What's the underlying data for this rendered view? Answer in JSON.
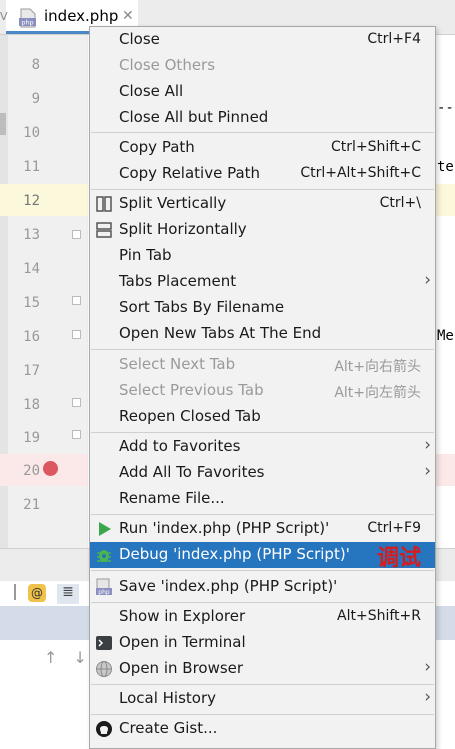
{
  "tab": {
    "title": "index.php",
    "icon": "php-file-icon",
    "file_type_badge": "php"
  },
  "sidebar_letter": "V",
  "line_numbers": [
    "8",
    "9",
    "10",
    "11",
    "12",
    "13",
    "14",
    "15",
    "16",
    "17",
    "18",
    "19",
    "20",
    "21"
  ],
  "editor_fragments": [
    "--",
    "te",
    "Me"
  ],
  "toolbar": {
    "at_icon_label": "@"
  },
  "menu": {
    "close": {
      "label": "Close",
      "shortcut": "Ctrl+F4"
    },
    "close_others": {
      "label": "Close Others"
    },
    "close_all": {
      "label": "Close All"
    },
    "close_all_but_pinned": {
      "label": "Close All but Pinned"
    },
    "copy_path": {
      "label": "Copy Path",
      "shortcut": "Ctrl+Shift+C"
    },
    "copy_relative_path": {
      "label": "Copy Relative Path",
      "shortcut": "Ctrl+Alt+Shift+C"
    },
    "split_vertically": {
      "label": "Split Vertically",
      "shortcut": "Ctrl+\\"
    },
    "split_horizontally": {
      "label": "Split Horizontally"
    },
    "pin_tab": {
      "label": "Pin Tab"
    },
    "tabs_placement": {
      "label": "Tabs Placement"
    },
    "sort_tabs": {
      "label": "Sort Tabs By Filename"
    },
    "open_new_tabs_end": {
      "label": "Open New Tabs At The End"
    },
    "select_next_tab": {
      "label": "Select Next Tab",
      "shortcut": "Alt+向右箭头"
    },
    "select_previous_tab": {
      "label": "Select Previous Tab",
      "shortcut": "Alt+向左箭头"
    },
    "reopen_closed_tab": {
      "label": "Reopen Closed Tab"
    },
    "add_to_favorites": {
      "label": "Add to Favorites"
    },
    "add_all_to_favorites": {
      "label": "Add All To Favorites"
    },
    "rename_file": {
      "label": "Rename File..."
    },
    "run": {
      "label": "Run 'index.php (PHP Script)'",
      "shortcut": "Ctrl+F9"
    },
    "debug": {
      "label": "Debug 'index.php (PHP Script)'",
      "annotation": "调试"
    },
    "save": {
      "label": "Save 'index.php (PHP Script)'"
    },
    "show_in_explorer": {
      "label": "Show in Explorer",
      "shortcut": "Alt+Shift+R"
    },
    "open_in_terminal": {
      "label": "Open in Terminal"
    },
    "open_in_browser": {
      "label": "Open in Browser"
    },
    "local_history": {
      "label": "Local History"
    },
    "create_gist": {
      "label": "Create Gist..."
    },
    "submenu_arrow": "›"
  },
  "colors": {
    "selection": "#2675bf",
    "annotation": "#d81c1c",
    "breakpoint": "#db5860",
    "run_green": "#3aa84a"
  }
}
